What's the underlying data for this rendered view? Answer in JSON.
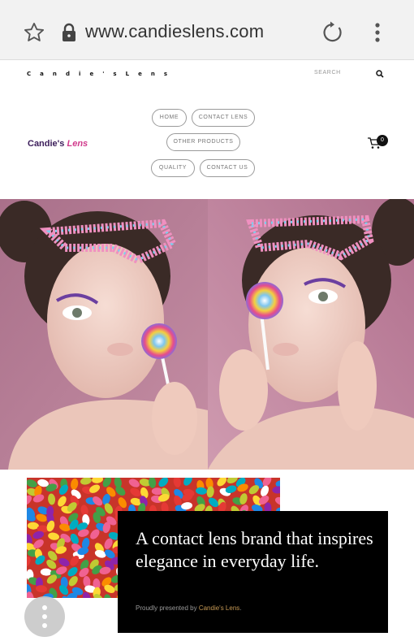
{
  "browser": {
    "url": "www.candieslens.com",
    "icons": {
      "bookmark": "star-icon",
      "secure": "lock-icon",
      "reload": "reload-icon",
      "menu": "more-vert-icon"
    }
  },
  "site": {
    "topbar_brand": "C a n d i e ' s   L e n s",
    "search_placeholder": "SEARCH",
    "logo_part1": "Candie's",
    "logo_part2": "Lens",
    "cart_count": "0",
    "nav": {
      "home": "HOME",
      "contact_lens": "CONTACT LENS",
      "other_products": "OTHER PRODUCTS",
      "quality": "QUALITY",
      "contact_us": "CONTACT US"
    }
  },
  "feature": {
    "headline": "A contact lens brand that inspires elegance in everyday life.",
    "byline_prefix": "Proudly presented by ",
    "byline_link": "Candie's Lens",
    "byline_suffix": "."
  },
  "colors": {
    "brand_dark": "#3b1d5a",
    "brand_pink": "#d13a8c",
    "hero_bg": "#b77a93",
    "card_bg": "#000000"
  }
}
